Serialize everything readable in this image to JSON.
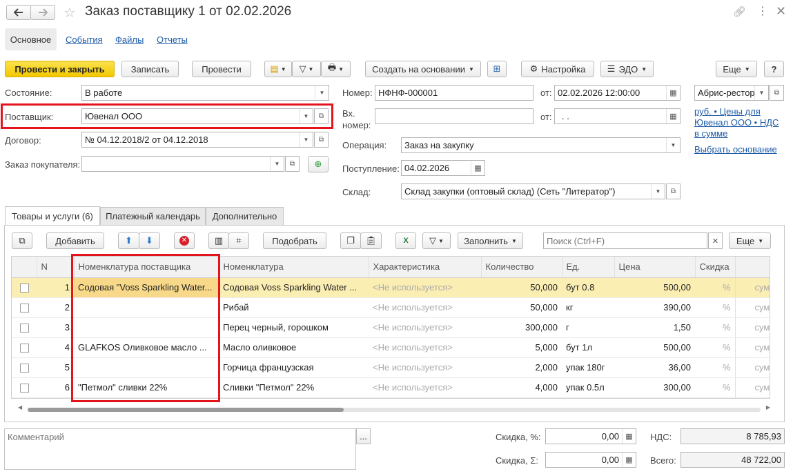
{
  "window": {
    "title": "Заказ поставщику 1 от 02.02.2026",
    "back_icon": "arrow-left-icon",
    "forward_icon": "arrow-right-icon"
  },
  "nav_tabs": [
    "Основное",
    "События",
    "Файлы",
    "Отчеты"
  ],
  "toolbar": {
    "post_close": "Провести и закрыть",
    "save": "Записать",
    "post": "Провести",
    "create_based": "Создать на основании",
    "settings": "Настройка",
    "edo": "ЭДО",
    "more": "Еще",
    "help": "?"
  },
  "form": {
    "state_label": "Состояние:",
    "state_value": "В работе",
    "supplier_label": "Поставщик:",
    "supplier_value": "Ювенал ООО",
    "contract_label": "Договор:",
    "contract_value": "№ 04.12.2018/2 от 04.12.2018",
    "customer_order_label": "Заказ покупателя:",
    "customer_order_value": "",
    "number_label": "Номер:",
    "number_value": "НФНФ-000001",
    "from_label": "от:",
    "date_value": "02.02.2026 12:00:00",
    "in_number_label_1": "Вх.",
    "in_number_label_2": "номер:",
    "in_number_value": "",
    "in_date_value": " .  .",
    "operation_label": "Операция:",
    "operation_value": "Заказ на закупку",
    "receipt_label": "Поступление:",
    "receipt_value": "04.02.2026",
    "warehouse_label": "Склад:",
    "warehouse_value": "Склад закупки (оптовый склад) (Сеть \"Литератор\")",
    "org_value": "Абрис-ресторан",
    "price_link_1": "руб. • Цены для",
    "price_link_2": "Ювенал ООО • НДС",
    "price_link_3": "в сумме",
    "choose_basis": "Выбрать основание"
  },
  "doc_tabs": [
    "Товары и услуги (6)",
    "Платежный календарь",
    "Дополнительно"
  ],
  "table_toolbar": {
    "add": "Добавить",
    "pick": "Подобрать",
    "fill": "Заполнить",
    "search_placeholder": "Поиск (Ctrl+F)",
    "more": "Еще"
  },
  "table": {
    "columns": [
      "N",
      "Номенклатура поставщика",
      "Номенклатура",
      "Характеристика",
      "Количество",
      "Ед.",
      "Цена",
      "Скидка"
    ],
    "rows": [
      {
        "n": "1",
        "supplier_item": "Содовая \"Voss Sparkling Water...",
        "item": "Содовая Voss Sparkling Water ...",
        "char": "<Не используется>",
        "qty": "50,000",
        "unit": "бут 0.8",
        "price": "500,00",
        "disc": "%",
        "sum": "сумм"
      },
      {
        "n": "2",
        "supplier_item": "",
        "item": "Рибай",
        "char": "<Не используется>",
        "qty": "50,000",
        "unit": "кг",
        "price": "390,00",
        "disc": "%",
        "sum": "сумм"
      },
      {
        "n": "3",
        "supplier_item": "",
        "item": "Перец черный, горошком",
        "char": "<Не используется>",
        "qty": "300,000",
        "unit": "г",
        "price": "1,50",
        "disc": "%",
        "sum": "сумм"
      },
      {
        "n": "4",
        "supplier_item": "GLAFKOS Оливковое масло ...",
        "item": "Масло оливковое",
        "char": "<Не используется>",
        "qty": "5,000",
        "unit": "бут 1л",
        "price": "500,00",
        "disc": "%",
        "sum": "сумм"
      },
      {
        "n": "5",
        "supplier_item": "",
        "item": "Горчица французская",
        "char": "<Не используется>",
        "qty": "2,000",
        "unit": "упак 180г",
        "price": "36,00",
        "disc": "%",
        "sum": "сумм"
      },
      {
        "n": "6",
        "supplier_item": "\"Петмол\" сливки 22%",
        "item": "Сливки \"Петмол\" 22%",
        "char": "<Не используется>",
        "qty": "4,000",
        "unit": "упак 0.5л",
        "price": "300,00",
        "disc": "%",
        "sum": "сумм"
      }
    ]
  },
  "footer": {
    "comment_placeholder": "Комментарий",
    "discount_pct_label": "Скидка, %:",
    "discount_pct_value": "0,00",
    "discount_sum_label": "Скидка, Σ:",
    "discount_sum_value": "0,00",
    "vat_label": "НДС:",
    "vat_value": "8 785,93",
    "total_label": "Всего:",
    "total_value": "48 722,00"
  },
  "colors": {
    "primary_button": "#f3c800",
    "link": "#1d5ba8",
    "highlight_box": "#e3141c",
    "selected_row": "#fbeeb3"
  }
}
